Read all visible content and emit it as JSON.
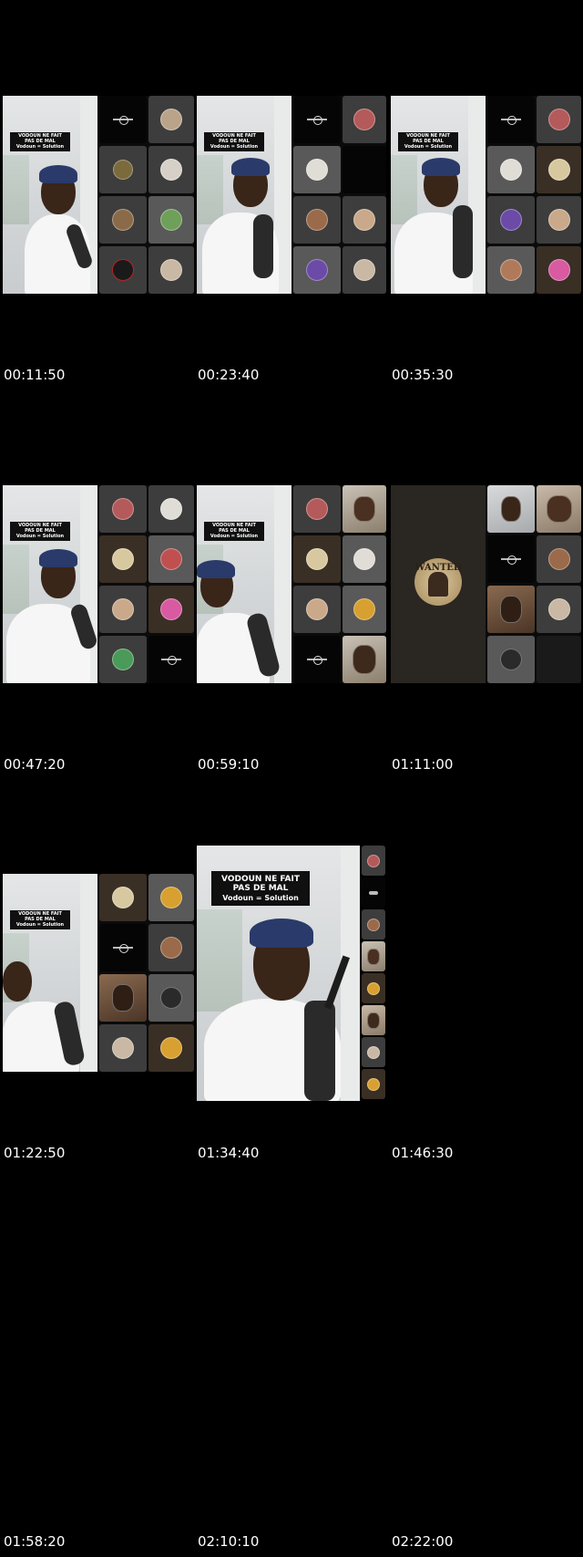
{
  "timestamps": [
    "00:11:50",
    "00:23:40",
    "00:35:30",
    "00:47:20",
    "00:59:10",
    "01:11:00",
    "01:22:50",
    "01:34:40",
    "01:46:30",
    "01:58:20",
    "02:10:10",
    "02:22:00"
  ],
  "caption": {
    "line1": "VODOUN NE FAIT",
    "line2": "PAS DE MAL",
    "line3": "Vodoun = Solution"
  },
  "wanted_text": "WANTED",
  "colors": {
    "background": "#000000",
    "caption_bg": "#101010",
    "tile_dark": "#050505",
    "tile_gray": "#3d3d3d"
  }
}
